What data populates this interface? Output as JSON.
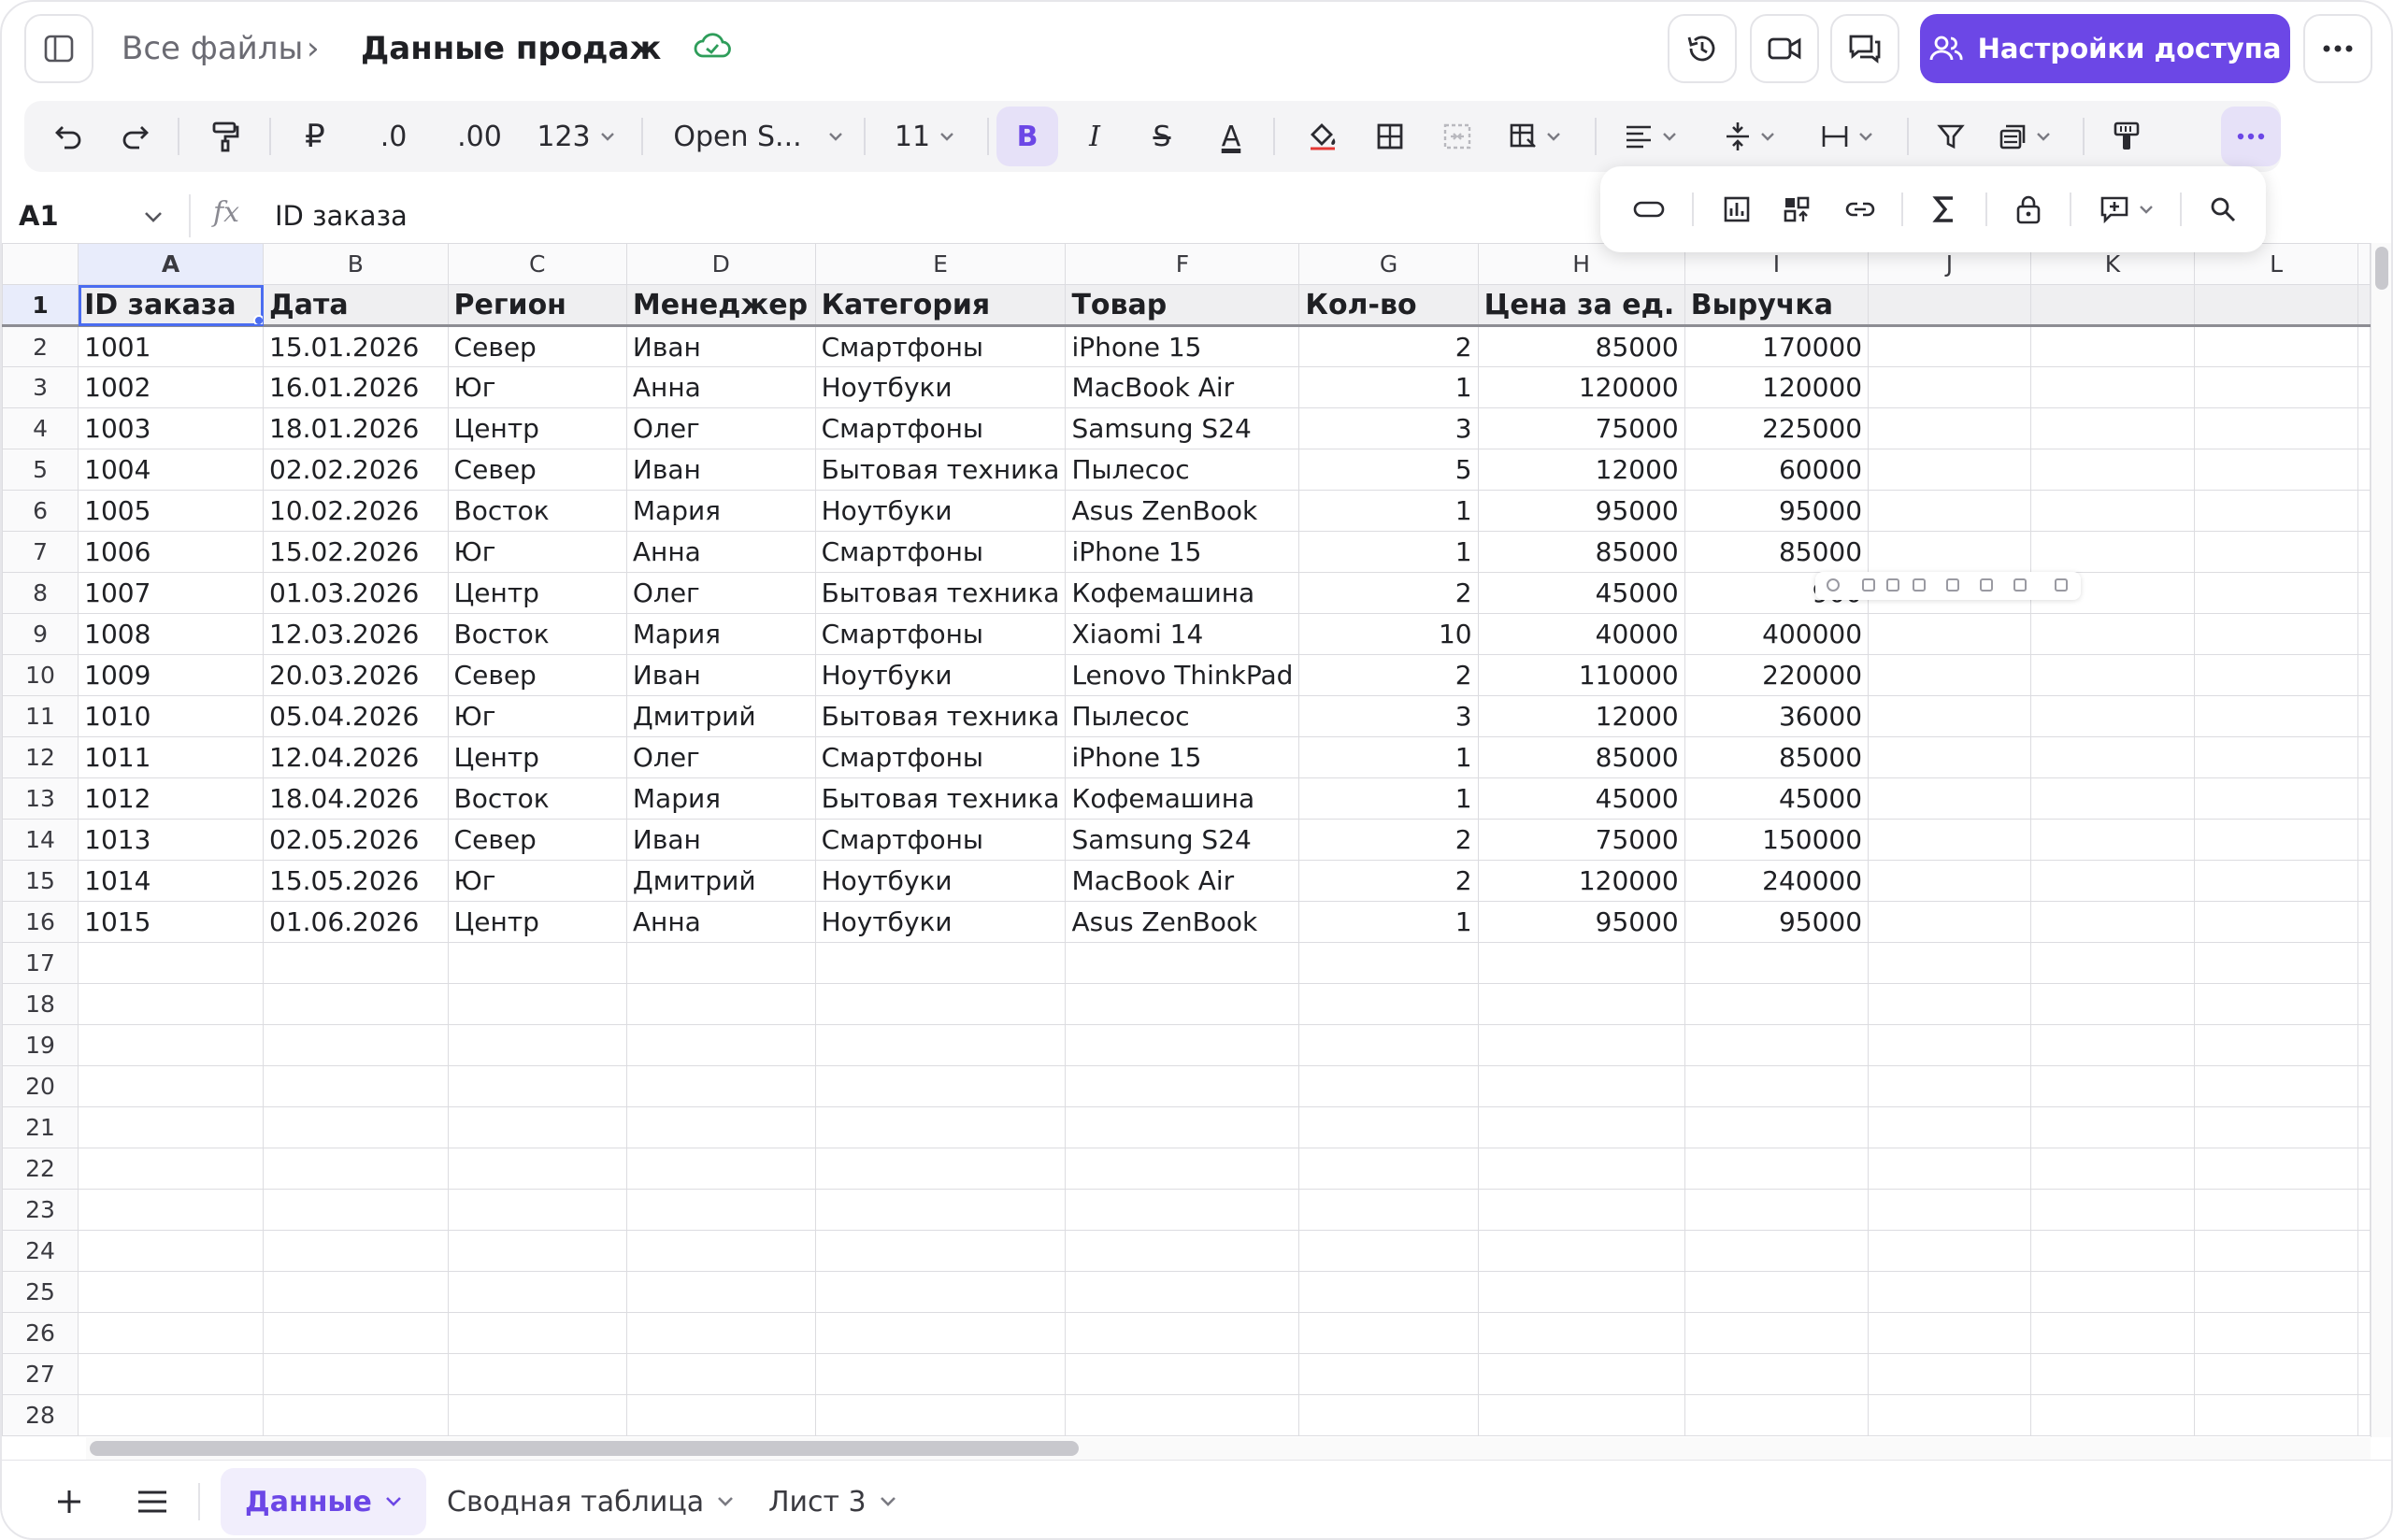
{
  "header": {
    "breadcrumb_root": "Все файлы",
    "breadcrumb_sep": "›",
    "document_title": "Данные продаж",
    "share_label": "Настройки доступа"
  },
  "toolbar": {
    "currency": "₽",
    "decrease_decimal": ".0",
    "increase_decimal": ".00",
    "number_format": "123",
    "font_name": "Open S...",
    "font_size": "11",
    "bold": "B",
    "italic": "I",
    "strikethrough": "S",
    "text_color": "A"
  },
  "formula_bar": {
    "cell_ref": "A1",
    "fx": "fx",
    "value": "ID заказа"
  },
  "grid": {
    "columns": [
      "A",
      "B",
      "C",
      "D",
      "E",
      "F",
      "G",
      "H",
      "I",
      "J",
      "K",
      "L"
    ],
    "headers": [
      "ID заказа",
      "Дата",
      "Регион",
      "Менеджер",
      "Категория",
      "Товар",
      "Кол-во",
      "Цена за ед.",
      "Выручка"
    ],
    "rows": [
      [
        "1001",
        "15.01.2026",
        "Север",
        "Иван",
        "Смартфоны",
        "iPhone 15",
        "2",
        "85000",
        "170000"
      ],
      [
        "1002",
        "16.01.2026",
        "Юг",
        "Анна",
        "Ноутбуки",
        "MacBook Air",
        "1",
        "120000",
        "120000"
      ],
      [
        "1003",
        "18.01.2026",
        "Центр",
        "Олег",
        "Смартфоны",
        "Samsung S24",
        "3",
        "75000",
        "225000"
      ],
      [
        "1004",
        "02.02.2026",
        "Север",
        "Иван",
        "Бытовая техника",
        "Пылесос",
        "5",
        "12000",
        "60000"
      ],
      [
        "1005",
        "10.02.2026",
        "Восток",
        "Мария",
        "Ноутбуки",
        "Asus ZenBook",
        "1",
        "95000",
        "95000"
      ],
      [
        "1006",
        "15.02.2026",
        "Юг",
        "Анна",
        "Смартфоны",
        "iPhone 15",
        "1",
        "85000",
        "85000"
      ],
      [
        "1007",
        "01.03.2026",
        "Центр",
        "Олег",
        "Бытовая техника",
        "Кофемашина",
        "2",
        "45000",
        "900"
      ],
      [
        "1008",
        "12.03.2026",
        "Восток",
        "Мария",
        "Смартфоны",
        "Xiaomi 14",
        "10",
        "40000",
        "400000"
      ],
      [
        "1009",
        "20.03.2026",
        "Север",
        "Иван",
        "Ноутбуки",
        "Lenovo ThinkPad",
        "2",
        "110000",
        "220000"
      ],
      [
        "1010",
        "05.04.2026",
        "Юг",
        "Дмитрий",
        "Бытовая техника",
        "Пылесос",
        "3",
        "12000",
        "36000"
      ],
      [
        "1011",
        "12.04.2026",
        "Центр",
        "Олег",
        "Смартфоны",
        "iPhone 15",
        "1",
        "85000",
        "85000"
      ],
      [
        "1012",
        "18.04.2026",
        "Восток",
        "Мария",
        "Бытовая техника",
        "Кофемашина",
        "1",
        "45000",
        "45000"
      ],
      [
        "1013",
        "02.05.2026",
        "Север",
        "Иван",
        "Смартфоны",
        "Samsung S24",
        "2",
        "75000",
        "150000"
      ],
      [
        "1014",
        "15.05.2026",
        "Юг",
        "Дмитрий",
        "Ноутбуки",
        "MacBook Air",
        "2",
        "120000",
        "240000"
      ],
      [
        "1015",
        "01.06.2026",
        "Центр",
        "Анна",
        "Ноутбуки",
        "Asus ZenBook",
        "1",
        "95000",
        "95000"
      ]
    ],
    "numeric_columns": [
      6,
      7,
      8
    ],
    "row_numbers": [
      "1",
      "2",
      "3",
      "4",
      "5",
      "6",
      "7",
      "8",
      "9",
      "10",
      "11",
      "12",
      "13",
      "14",
      "15",
      "16",
      "17",
      "18",
      "19",
      "20",
      "21",
      "22",
      "23",
      "24",
      "25",
      "26",
      "27",
      "28"
    ]
  },
  "tabs": [
    {
      "label": "Данные",
      "active": true
    },
    {
      "label": "Сводная таблица",
      "active": false
    },
    {
      "label": "Лист 3",
      "active": false
    }
  ],
  "colors": {
    "accent": "#6c47e6",
    "selection": "#4a6cf0",
    "sync_ok": "#2e9d5a"
  },
  "icons": {
    "sidebar_toggle": "sidebar-toggle-icon",
    "sync": "cloud-check-icon",
    "history": "history-icon",
    "video": "video-icon",
    "comments": "comments-icon",
    "users": "users-icon",
    "more": "more-horizontal-icon"
  }
}
